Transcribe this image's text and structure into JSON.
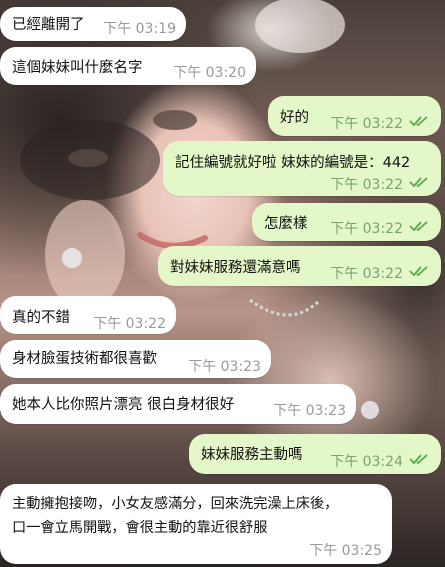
{
  "chat": {
    "messages": [
      {
        "direction": "in",
        "text": "已經離開了",
        "time": "下午 03:19"
      },
      {
        "direction": "in",
        "text": "這個妹妹叫什麼名字",
        "time": "下午 03:20"
      },
      {
        "direction": "out",
        "text": "好的",
        "time": "下午 03:22",
        "read_icon": "double-check-icon"
      },
      {
        "direction": "out",
        "text": "記住編號就好啦 妹妹的編號是：442",
        "time": "下午 03:22",
        "read_icon": "double-check-icon"
      },
      {
        "direction": "out",
        "text": "怎麼樣",
        "time": "下午 03:22",
        "read_icon": "double-check-icon"
      },
      {
        "direction": "out",
        "text": "對妹妹服務還滿意嗎",
        "time": "下午 03:22",
        "read_icon": "double-check-icon"
      },
      {
        "direction": "in",
        "text": "真的不錯",
        "time": "下午 03:22"
      },
      {
        "direction": "in",
        "text": "身材臉蛋技術都很喜歡",
        "time": "下午 03:23"
      },
      {
        "direction": "in",
        "text": "她本人比你照片漂亮 很白身材很好",
        "time": "下午 03:23"
      },
      {
        "direction": "out",
        "text": "妹妹服務主動嗎",
        "time": "下午 03:24",
        "read_icon": "double-check-icon"
      },
      {
        "direction": "in",
        "text_lines": [
          "主動擁抱接吻，小女友感滿分，回來洗完澡上床後，",
          "口一會立馬開戰，會很主動的靠近很舒服"
        ],
        "time": "下午 03:25"
      }
    ]
  },
  "colors": {
    "incoming_bubble": "#ffffff",
    "outgoing_bubble": "#e4f7c8",
    "incoming_time": "#9a9a9a",
    "outgoing_time": "#7aa36c",
    "read_check": "#5aa84c"
  }
}
